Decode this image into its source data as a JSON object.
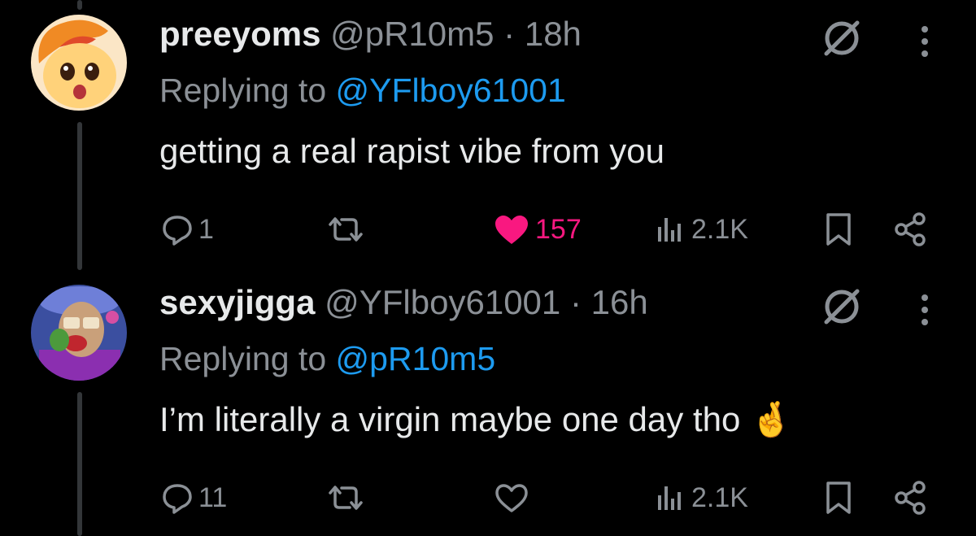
{
  "tweets": [
    {
      "avatar": "pony-avatar",
      "name": "preeyoms",
      "handle": "@pR10m5",
      "separator": "·",
      "time": "18h",
      "replying_prefix": "Replying to",
      "replying_to": "@YFlboy61001",
      "text": "getting a real rapist vibe from you",
      "replies": "1",
      "retweets": "",
      "likes": "157",
      "liked": true,
      "views": "2.1K"
    },
    {
      "avatar": "cartoon-avatar",
      "name": "sexyjigga",
      "handle": "@YFlboy61001",
      "separator": "·",
      "time": "16h",
      "replying_prefix": "Replying to",
      "replying_to": "@pR10m5",
      "text": "I’m literally a virgin maybe one day tho",
      "emoji": "🤞",
      "replies": "11",
      "retweets": "",
      "likes": "",
      "liked": false,
      "views": "2.1K"
    }
  ],
  "colors": {
    "background": "#000000",
    "text": "#e7e9ea",
    "secondary": "#8b9096",
    "link": "#1d9bf0",
    "like": "#f91880"
  }
}
